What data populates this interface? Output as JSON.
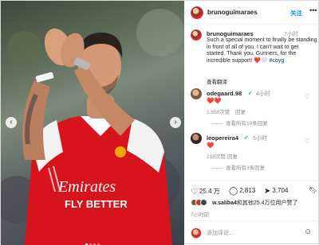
{
  "post": {
    "username": "brunoguimaraes",
    "follow_label": "关注",
    "more_icon": "more-dots-icon",
    "caption": {
      "username": "brunoguimaraes",
      "verified_icon": "verified-badge-icon",
      "time": "7小时",
      "text": "Such a special moment to finally be standing in front of all of you. I can't wait to get started. Thank you, Gunners, for the incredible support! ❤️🤍 ",
      "hashtag": "#coyg",
      "translate_label": "查看翻译"
    },
    "photo": {
      "shirt_sponsor_line1": "Emirates",
      "shirt_sponsor_line2": "FLY BETTER",
      "prev_icon": "chevron-left-icon",
      "next_icon": "chevron-right-icon"
    },
    "comments": [
      {
        "username": "odegaard.98",
        "verified_icon": "verified-badge-icon",
        "time": "4小时",
        "body": "❤️❤️",
        "likes": "1,650次赞",
        "reply_label": "回复",
        "view_replies": "查看所有10条回复"
      },
      {
        "username": "leopereira4",
        "verified_icon": "verified-badge-icon",
        "time": "5小时",
        "body": "❤️",
        "likes": "218次赞",
        "reply_label": "回复",
        "view_replies": "查看所有3条回复"
      }
    ],
    "actions": {
      "like_icon": "heart-icon",
      "like_count": "25.4 万",
      "comment_icon": "comment-icon",
      "comment_count": "2,813",
      "share_icon": "share-icon",
      "share_count": "3,704",
      "bookmark_icon": "bookmark-icon"
    },
    "liked_by": {
      "user": "w.saliba4",
      "rest": "和其他25.4万位用户赞了"
    },
    "post_time": "7小时前",
    "add_comment": {
      "placeholder": "添加评论...",
      "emoji_icon": "emoji-icon"
    }
  },
  "colors": {
    "accent": "#0095f6",
    "shirt_red": "#d7141c",
    "text": "#262626",
    "muted": "#8e8e8e"
  }
}
